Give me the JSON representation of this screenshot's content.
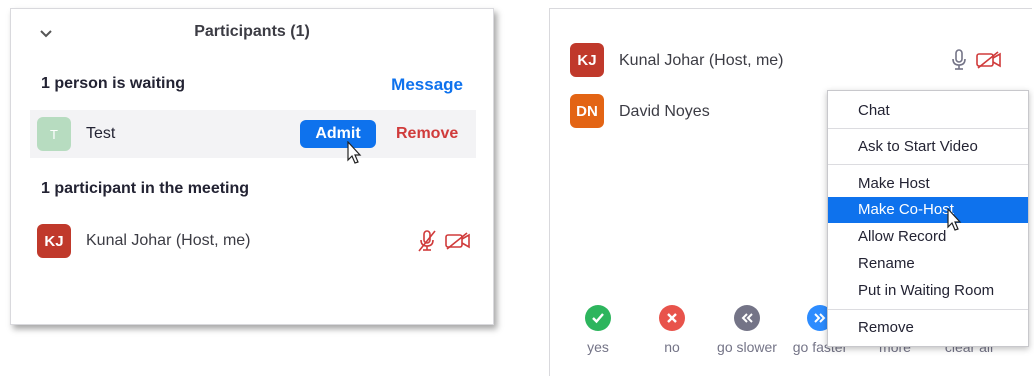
{
  "left_panel": {
    "title": "Participants (1)",
    "waiting_header": "1 person is waiting",
    "message_label": "Message",
    "waiting": {
      "initial": "T",
      "name": "Test",
      "admit_label": "Admit",
      "remove_label": "Remove"
    },
    "meeting_header": "1 participant in the meeting",
    "host": {
      "initials": "KJ",
      "name": "Kunal Johar (Host, me)"
    }
  },
  "right_panel": {
    "participants": [
      {
        "initials": "KJ",
        "name": "Kunal Johar (Host, me)"
      },
      {
        "initials": "DN",
        "name": "David Noyes"
      }
    ],
    "reactions": [
      {
        "label": "yes",
        "icon": "check-icon",
        "color": "#2db55d"
      },
      {
        "label": "no",
        "icon": "x-icon",
        "color": "#e8534b"
      },
      {
        "label": "go slower",
        "icon": "rewind-icon",
        "color": "#747487"
      },
      {
        "label": "go faster",
        "icon": "fast-forward-icon",
        "color": "#2d8cff"
      },
      {
        "label": "more",
        "icon": "more-icon",
        "color": "#747487"
      },
      {
        "label": "clear all",
        "icon": "clear-icon",
        "color": "#747487"
      }
    ]
  },
  "context_menu": {
    "items": [
      {
        "label": "Chat"
      },
      {
        "label": "Ask to Start Video"
      },
      {
        "label": "Make Host"
      },
      {
        "label": "Make Co-Host",
        "active": true
      },
      {
        "label": "Allow Record"
      },
      {
        "label": "Rename"
      },
      {
        "label": "Put in Waiting Room"
      },
      {
        "label": "Remove"
      }
    ]
  },
  "colors": {
    "accent": "#0e72ed",
    "danger": "#d03b3b",
    "avatar_kj": "#c0392b",
    "avatar_dn": "#e36414",
    "avatar_t": "#b7dcc0"
  }
}
